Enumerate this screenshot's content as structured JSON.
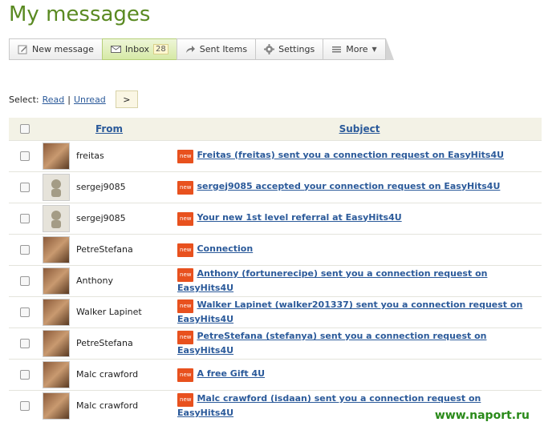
{
  "page": {
    "title": "My messages"
  },
  "toolbar": {
    "new_message": "New message",
    "inbox": "Inbox",
    "inbox_count": "28",
    "sent_items": "Sent Items",
    "settings": "Settings",
    "more": "More"
  },
  "select": {
    "label": "Select:",
    "read": "Read",
    "separator": "|",
    "unread": "Unread",
    "go": ">"
  },
  "table": {
    "headers": {
      "from": "From",
      "subject": "Subject"
    },
    "new_badge": "new",
    "rows": [
      {
        "from": "freitas",
        "subject": "Freitas (freitas) sent you a connection request on EasyHits4U",
        "avatar": "photo"
      },
      {
        "from": "sergej9085",
        "subject": "sergej9085 accepted your connection request on EasyHits4U",
        "avatar": "default"
      },
      {
        "from": "sergej9085",
        "subject": "Your new 1st level referral at EasyHits4U",
        "avatar": "default"
      },
      {
        "from": "PetreStefana",
        "subject": "Connection",
        "avatar": "photo"
      },
      {
        "from": "Anthony",
        "subject": "Anthony (fortunerecipe) sent you a connection request on EasyHits4U",
        "avatar": "photo"
      },
      {
        "from": "Walker Lapinet",
        "subject": "Walker Lapinet (walker201337) sent you a connection request on EasyHits4U",
        "avatar": "photo"
      },
      {
        "from": "PetreStefana",
        "subject": "PetreStefana (stefanya) sent you a connection request on EasyHits4U",
        "avatar": "photo"
      },
      {
        "from": "Malc crawford",
        "subject": "A free Gift 4U",
        "avatar": "photo"
      },
      {
        "from": "Malc crawford",
        "subject": "Malc crawford (isdaan) sent you a connection request on EasyHits4U",
        "avatar": "photo"
      }
    ]
  },
  "watermark": "www.naport.ru",
  "colors": {
    "title": "#5a8a22",
    "link": "#2b5a9a",
    "new_badge": "#e8511e",
    "watermark": "#2a8a1a"
  }
}
